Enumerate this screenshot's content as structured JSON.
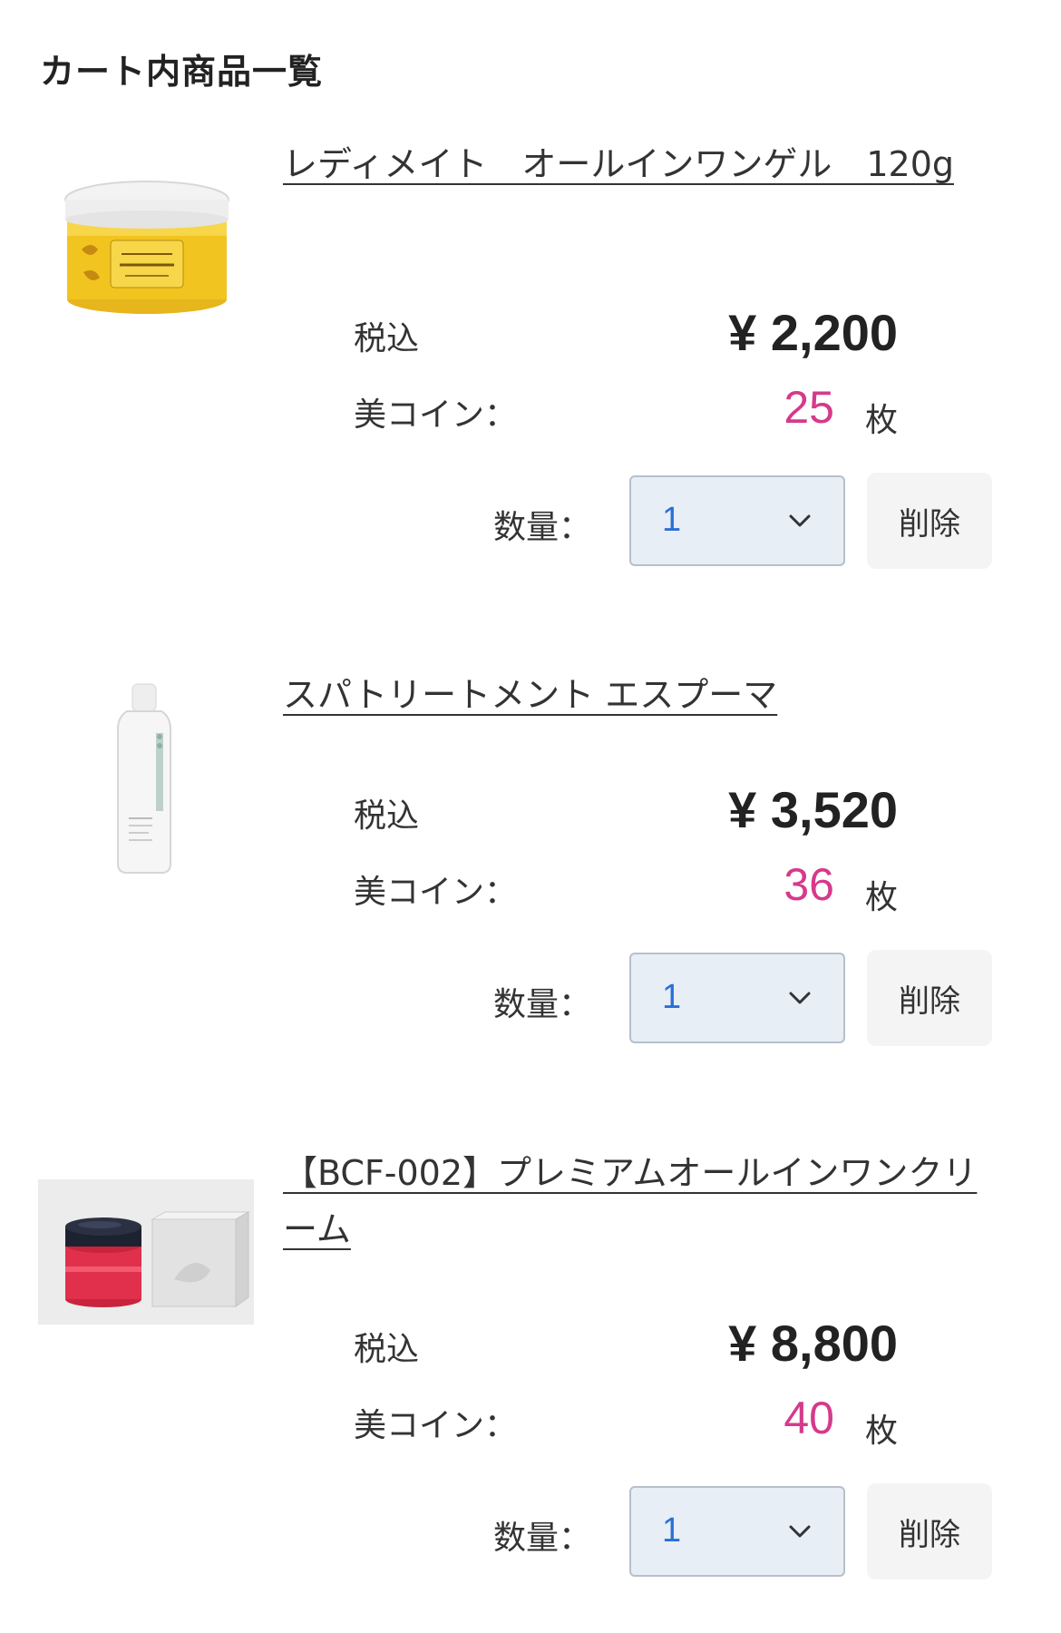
{
  "page": {
    "title": "カート内商品一覧"
  },
  "items": [
    {
      "name": "レディメイト　オールインワンゲル　120g",
      "tax_label": "税込",
      "price": "¥ 2,200",
      "coin_label": "美コイン：",
      "coins": "25",
      "coin_unit": "枚",
      "qty_label": "数量：",
      "qty_value": "1",
      "delete_label": "削除"
    },
    {
      "name": "スパトリートメント エスプーマ",
      "tax_label": "税込",
      "price": "¥ 3,520",
      "coin_label": "美コイン：",
      "coins": "36",
      "coin_unit": "枚",
      "qty_label": "数量：",
      "qty_value": "1",
      "delete_label": "削除"
    },
    {
      "name": "【BCF-002】プレミアムオールインワンクリーム",
      "tax_label": "税込",
      "price": "¥ 8,800",
      "coin_label": "美コイン：",
      "coins": "40",
      "coin_unit": "枚",
      "qty_label": "数量：",
      "qty_value": "1",
      "delete_label": "削除"
    }
  ],
  "colors": {
    "coin": "#d53a8b",
    "select_bg": "#e8eef6",
    "select_value": "#2a6fd6",
    "delete_bg": "#f4f4f4"
  },
  "icons": {
    "select_arrow": "chevron-down-icon"
  }
}
